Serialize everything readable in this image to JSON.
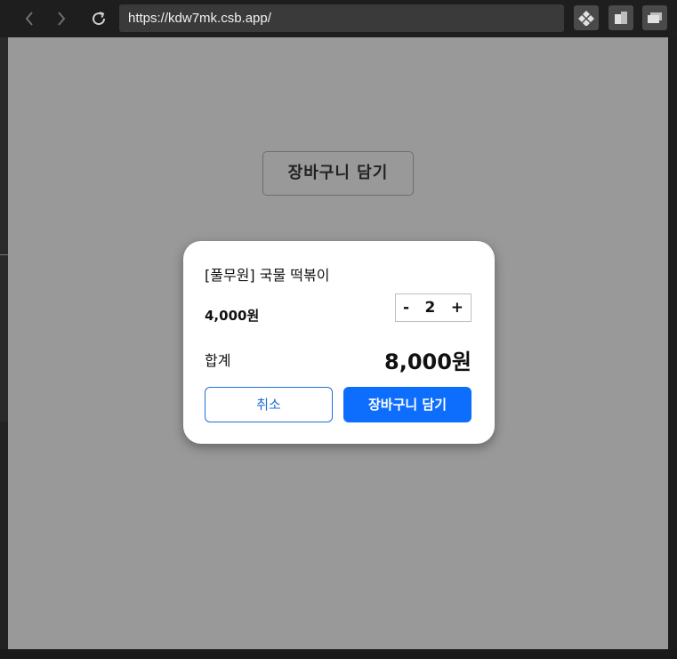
{
  "browser": {
    "url": "https://kdw7mk.csb.app/",
    "icons": [
      "back-icon",
      "forward-icon",
      "reload-icon",
      "devtools-icon",
      "split-view-icon",
      "new-window-icon"
    ]
  },
  "page": {
    "open_button_label": "장바구니 담기"
  },
  "modal": {
    "product_name": "[풀무원] 국물 떡볶이",
    "unit_price": "4,000원",
    "quantity": {
      "minus_label": "-",
      "value": "2",
      "plus_label": "+"
    },
    "total_label": "합계",
    "total_value": "8,000원",
    "cancel_label": "취소",
    "add_label": "장바구니 담기"
  },
  "colors": {
    "overlay": "#999999",
    "primary": "#0d6efd",
    "outline": "#1f6fd6"
  }
}
